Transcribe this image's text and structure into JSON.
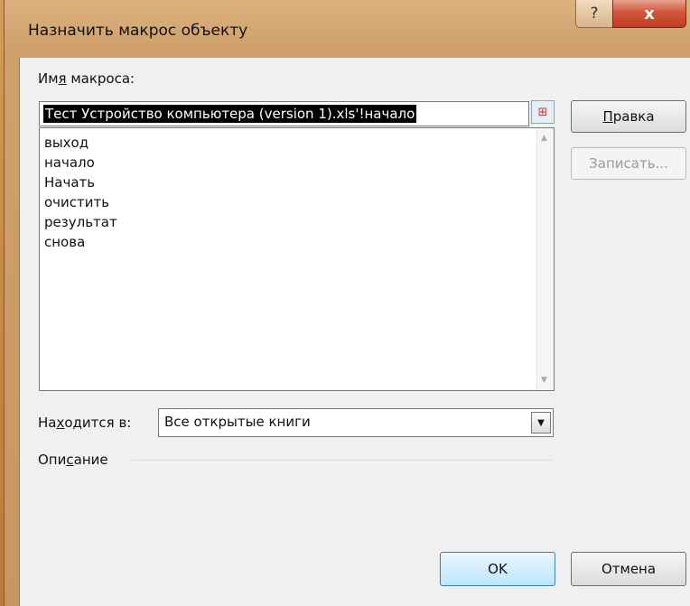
{
  "window": {
    "title": "Назначить макрос объекту",
    "help_glyph": "?",
    "close_glyph": "x"
  },
  "macro_name": {
    "label_prefix": "Им",
    "label_hotkey": "я",
    "label_suffix": " макроса:",
    "value": "Тест Устройство компьютера (version 1).xls'!начало"
  },
  "macro_list": {
    "items": [
      "выход",
      "начало",
      "Начать",
      "очистить",
      "результат",
      "снова"
    ]
  },
  "buttons": {
    "edit_hotkey": "П",
    "edit_rest": "равка",
    "record": "Записать...",
    "ok": "OK",
    "cancel": "Отмена"
  },
  "location": {
    "label_prefix": "На",
    "label_hotkey": "х",
    "label_suffix": "одится в:",
    "value": "Все открытые книги"
  },
  "description": {
    "label_prefix": "Опи",
    "label_hotkey": "с",
    "label_suffix": "ание"
  }
}
